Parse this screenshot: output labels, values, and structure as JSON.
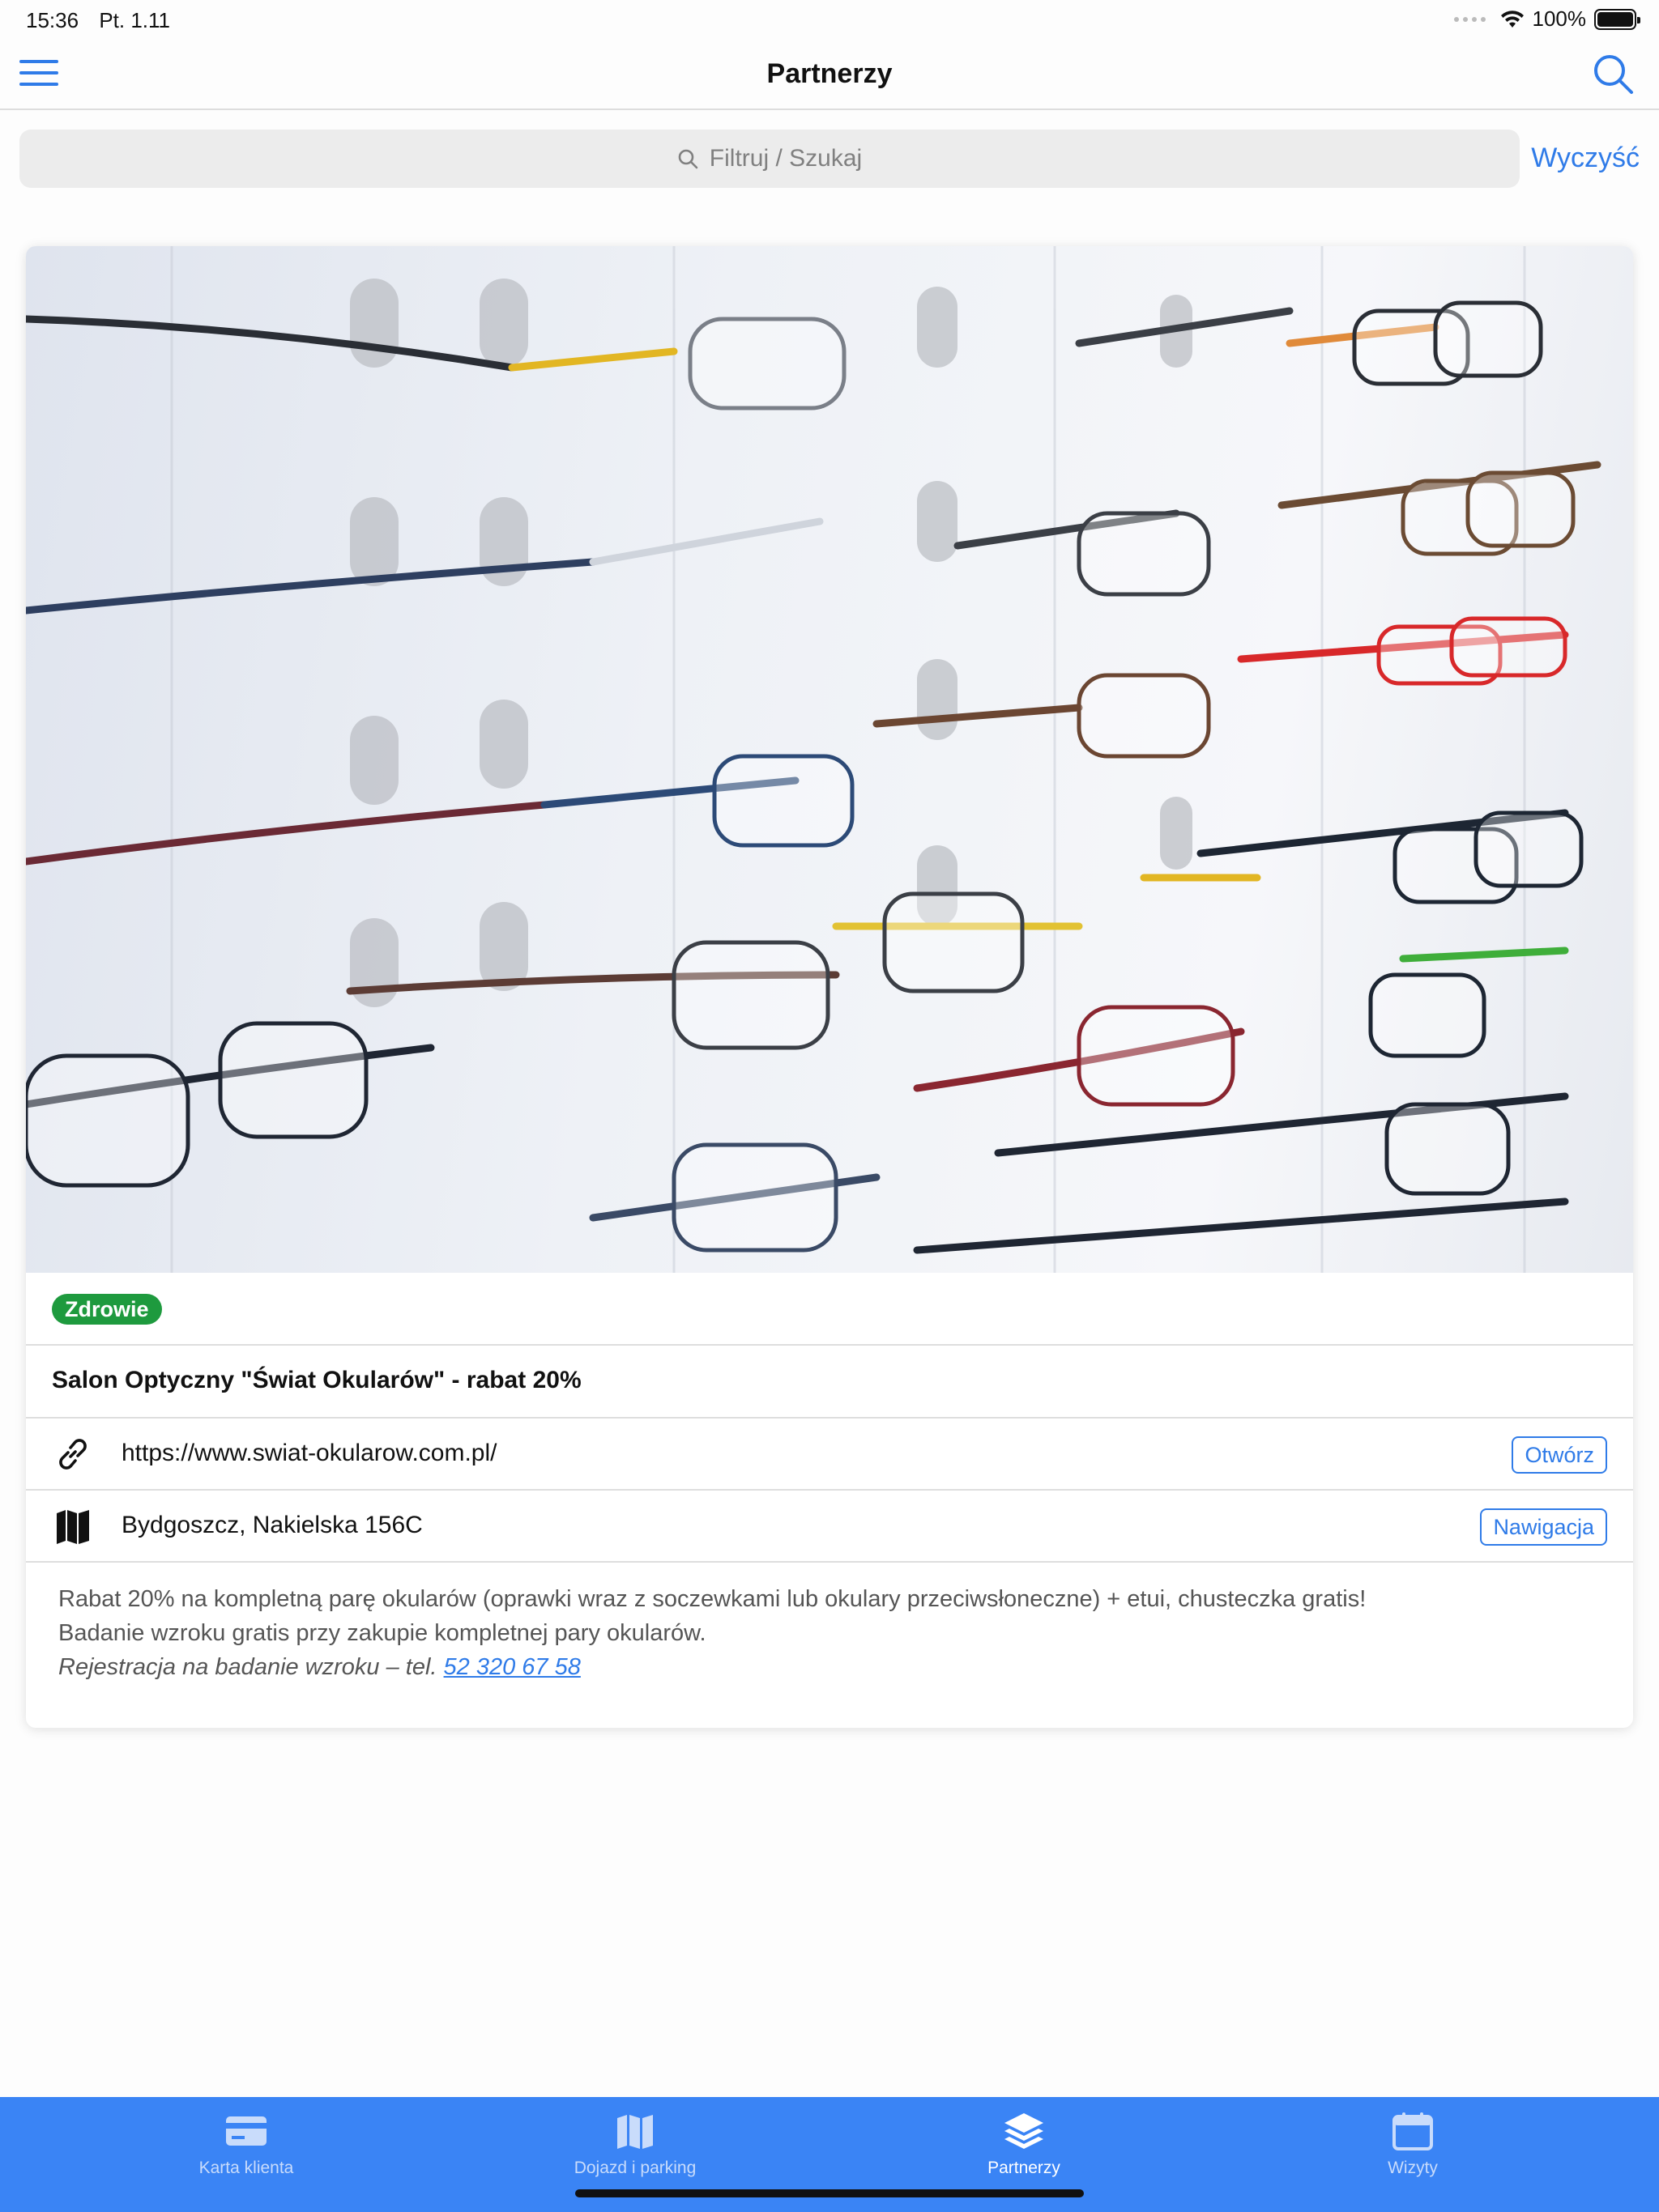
{
  "status": {
    "time": "15:36",
    "date": "Pt. 1.11",
    "battery": "100%"
  },
  "nav": {
    "title": "Partnerzy",
    "menu_icon": "hamburger-icon",
    "search_icon": "search-icon"
  },
  "filter": {
    "placeholder": "Filtruj / Szukaj",
    "clear_label": "Wyczyść"
  },
  "partner": {
    "category": "Zdrowie",
    "category_color": "#1e9a3e",
    "title": "Salon Optyczny \"Świat Okularów\" - rabat 20%",
    "url": "https://www.swiat-okularow.com.pl/",
    "open_label": "Otwórz",
    "address": "Bydgoszcz, Nakielska 156C",
    "nav_label": "Nawigacja",
    "description_line1": "Rabat 20% na kompletną parę okularów (oprawki wraz z soczewkami lub okulary przeciwsłoneczne) + etui, chusteczka gratis!",
    "description_line2": "Badanie wzroku gratis przy zakupie kompletnej pary okularów.",
    "description_line3_prefix": "Rejestracja na badanie wzroku – tel. ",
    "phone": "52 320 67 58"
  },
  "tabs": [
    {
      "label": "Karta klienta",
      "icon": "card-icon",
      "active": false
    },
    {
      "label": "Dojazd i parking",
      "icon": "map-icon",
      "active": false
    },
    {
      "label": "Partnerzy",
      "icon": "layers-icon",
      "active": true
    },
    {
      "label": "Wizyty",
      "icon": "calendar-icon",
      "active": false
    }
  ],
  "colors": {
    "accent": "#2f7be8",
    "tabbar": "#3a84f5"
  }
}
